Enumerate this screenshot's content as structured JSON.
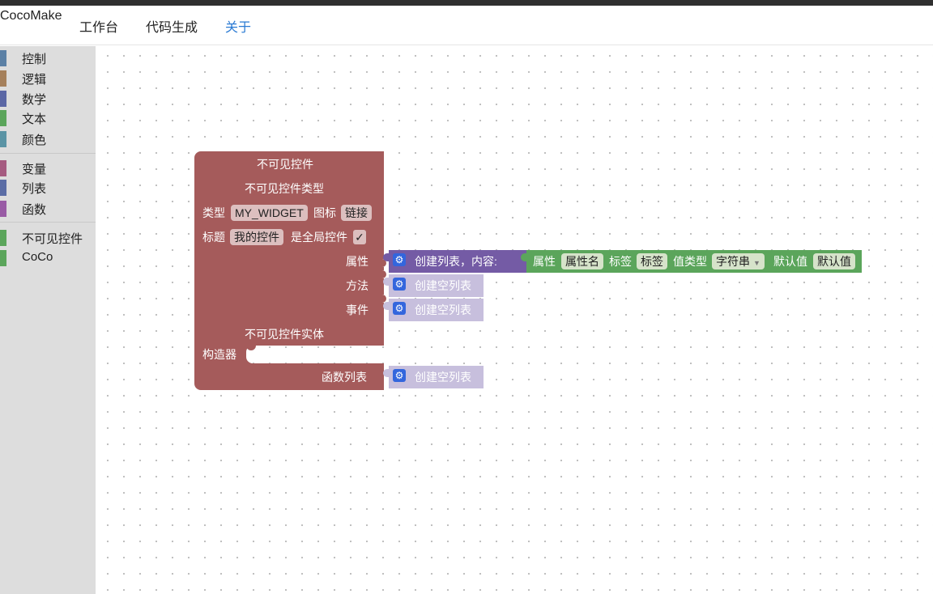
{
  "nav": {
    "brand": "CocoMake",
    "links": [
      "工作台",
      "代码生成",
      "关于"
    ]
  },
  "toolbox": {
    "categories": [
      {
        "label": "控制",
        "color": "#5b80a5"
      },
      {
        "label": "逻辑",
        "color": "#a5805b"
      },
      {
        "label": "数学",
        "color": "#5b67a5"
      },
      {
        "label": "文本",
        "color": "#5ba55b"
      },
      {
        "label": "颜色",
        "color": "#5b94a5"
      },
      {
        "label": "变量",
        "color": "#a55b80"
      },
      {
        "label": "列表",
        "color": "#5b6da5"
      },
      {
        "label": "函数",
        "color": "#995ba5"
      },
      {
        "label": "不可见控件",
        "color": "#5ba55b"
      },
      {
        "label": "CoCo",
        "color": "#5ba55b"
      }
    ]
  },
  "colors": {
    "main_block": "#a55b5b",
    "list_block": "#745ba5",
    "empty_list_block": "#c7bfdd",
    "property_block": "#5ba55b",
    "link_text": "#2a7ad3"
  },
  "main_block": {
    "title": "不可见控件",
    "section1": "不可见控件类型",
    "type_label": "类型",
    "type_value": "MY_WIDGET",
    "icon_label": "图标",
    "icon_value": "链接",
    "title_label": "标题",
    "title_value": "我的控件",
    "global_label": "是全局控件",
    "global_check": "✓",
    "props_label": "属性",
    "methods_label": "方法",
    "events_label": "事件",
    "section2": "不可见控件实体",
    "constructor_label": "构造器",
    "funcs_label": "函数列表"
  },
  "list_block": {
    "label": "创建列表，内容:",
    "icon": "gear-icon"
  },
  "property_block": {
    "prop_label": "属性",
    "prop_value": "属性名",
    "tag_label": "标签",
    "tag_value": "标签",
    "vtype_label": "值类型",
    "vtype_value": "字符串",
    "default_label": "默认值",
    "default_value": "默认值"
  },
  "empty_list_label": "创建空列表"
}
